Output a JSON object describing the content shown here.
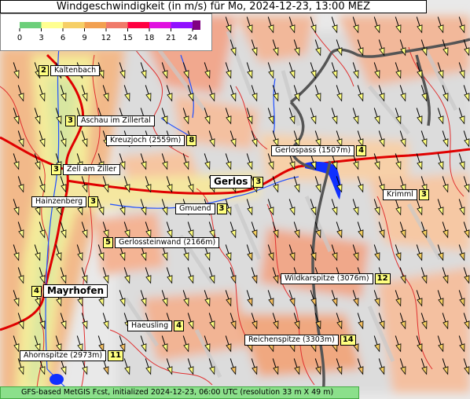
{
  "title": "Windgeschwindigkeit (in m/s) für Mo, 2024-12-23, 13:00 MEZ",
  "legend": {
    "ticks": [
      "0",
      "3",
      "6",
      "9",
      "12",
      "15",
      "18",
      "21",
      "24"
    ],
    "colors": [
      "#50c878",
      "#ffff80",
      "#f5d060",
      "#f0a050",
      "#f07070",
      "#f00040",
      "#e000e0",
      "#a000ff",
      "#800080"
    ]
  },
  "footer": "GFS-based MetGIS Fcst, initialized 2024-12-23, 06:00 UTC  (resolution 33 m X 49 m)",
  "places": [
    {
      "name": "Kaltenbach",
      "value": "2",
      "order": "val-first"
    },
    {
      "name": "Aschau im Zillertal",
      "value": "3",
      "order": "val-first"
    },
    {
      "name": "Kreuzjoch (2559m)",
      "value": "8",
      "order": "name-first"
    },
    {
      "name": "Zell am Ziller",
      "value": "3",
      "order": "val-first"
    },
    {
      "name": "Hainzenberg",
      "value": "3",
      "order": "name-first"
    },
    {
      "name": "Gerlos",
      "value": "3",
      "order": "name-first",
      "big": true
    },
    {
      "name": "Gerlospass (1507m)",
      "value": "4",
      "order": "name-first"
    },
    {
      "name": "Gmuend",
      "value": "3",
      "order": "name-first"
    },
    {
      "name": "Krimml",
      "value": "3",
      "order": "name-first"
    },
    {
      "name": "Gerlossteinwand (2166m)",
      "value": "5",
      "order": "val-first"
    },
    {
      "name": "Mayrhofen",
      "value": "4",
      "order": "val-first",
      "big": true
    },
    {
      "name": "Wildkarspitze (3076m)",
      "value": "12",
      "order": "name-first"
    },
    {
      "name": "Haeusling",
      "value": "4",
      "order": "name-first"
    },
    {
      "name": "Reichenspitze (3303m)",
      "value": "14",
      "order": "name-first"
    },
    {
      "name": "Ahornspitze (2973m)",
      "value": "11",
      "order": "name-first"
    }
  ]
}
